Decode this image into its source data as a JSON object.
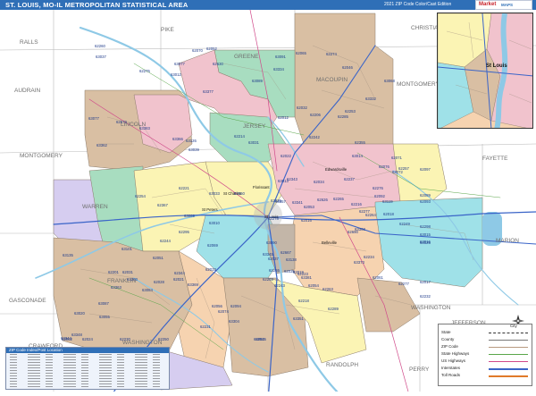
{
  "title": "ST. LOUIS, MO-IL METROPOLITAN STATISTICAL AREA",
  "subtitle": "2021 ZIP Code Color/Cast Edition",
  "logo": {
    "text_a": "Market",
    "text_b": "MAPS"
  },
  "colors": {
    "header": "#2f6fb7",
    "tan": "#d9bfa3",
    "pink": "#f1c3cd",
    "yellow": "#fbf4b4",
    "green": "#a8ddc0",
    "lavender": "#d6cdf0",
    "peach": "#f6d3b0",
    "cyan": "#9fe1e8",
    "river": "#8ec9e6",
    "interstate": "#3a64c8",
    "us_highway": "#d04a8a",
    "state_highway": "#5aa64a"
  },
  "county_labels": [
    "RALLS",
    "PIKE",
    "GREENE",
    "MACOUPIN",
    "MONTGOMERY",
    "AUDRAIN",
    "LINCOLN",
    "JERSEY",
    "MONTGOMERY",
    "WARREN",
    "FAYETTE",
    "GASCONADE",
    "FRANKLIN",
    "JEFFERSON",
    "MARION",
    "WASHINGTON",
    "WASHINGTON",
    "CRAWFORD",
    "RANDOLPH",
    "PERRY",
    "CHRISTIAN"
  ],
  "city_labels": [
    "St Charles",
    "St Peters",
    "Florissant",
    "St Louis",
    "Belleville",
    "Edwardsville"
  ],
  "zip_labels": [
    "62355",
    "62367",
    "62667",
    "62690",
    "63334",
    "62344",
    "62051",
    "62092",
    "62572",
    "62560",
    "63344",
    "62054",
    "62630",
    "62626",
    "62094",
    "62343",
    "62052",
    "62093",
    "62056",
    "62089",
    "63377",
    "63345",
    "62028",
    "62034",
    "62065",
    "62069",
    "62015",
    "62017",
    "62032",
    "63381",
    "62031",
    "62053",
    "62012",
    "62033",
    "62019",
    "62018",
    "63362",
    "62037",
    "63369",
    "62035",
    "62046",
    "62097",
    "62074",
    "62277",
    "63383",
    "62021",
    "62062",
    "62061",
    "62274",
    "62022",
    "63363",
    "62025",
    "62275",
    "62076",
    "62024",
    "62071",
    "62070",
    "63357",
    "63351",
    "63373",
    "63366",
    "63368",
    "62201",
    "62243",
    "62260",
    "62221",
    "62218",
    "62216",
    "62214",
    "63341",
    "63348",
    "62249",
    "62253",
    "62255",
    "62258",
    "62234",
    "62242",
    "62223",
    "62231",
    "63014",
    "63332",
    "62265",
    "63304",
    "62264",
    "62285",
    "62254",
    "62250",
    "62257",
    "63091",
    "63069",
    "62230",
    "62298",
    "63068",
    "62295",
    "63055",
    "62263",
    "63089",
    "63072",
    "62293",
    "63015",
    "63037",
    "63013",
    "63084",
    "62289",
    "63077",
    "62278",
    "63090",
    "62237",
    "63039",
    "62244",
    "63050",
    "62276",
    "63077",
    "62277",
    "63087",
    "62232",
    "63126",
    "63119",
    "63135",
    "63138",
    "63031",
    "63033",
    "63101",
    "63125",
    "62206",
    "63010",
    "63020",
    "63016",
    "63012",
    "62016"
  ],
  "inset": {
    "label": "St Louis"
  },
  "legend": {
    "items": [
      {
        "label": "State"
      },
      {
        "label": "County"
      },
      {
        "label": "ZIP Code"
      },
      {
        "label": "State Highways"
      },
      {
        "label": "US Highways"
      },
      {
        "label": "Interstates"
      },
      {
        "label": "Toll Roads"
      }
    ],
    "city_label": "City"
  },
  "zip_table": {
    "title": "ZIP Code Index/Post Location"
  }
}
